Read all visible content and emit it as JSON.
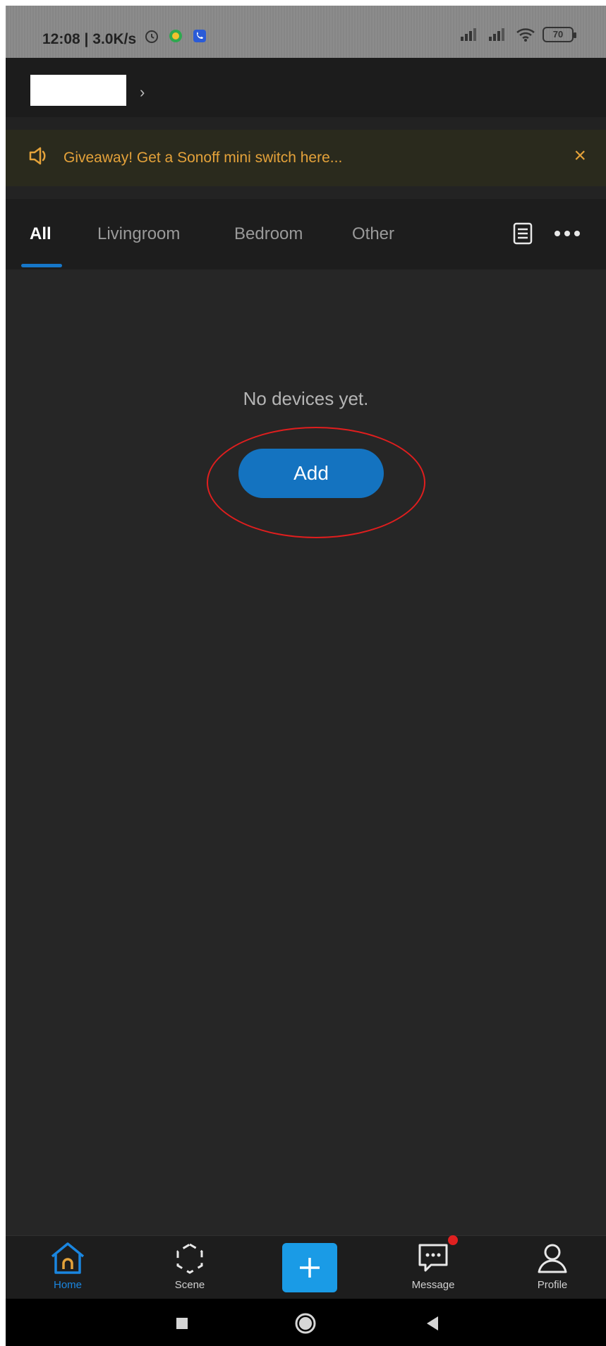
{
  "status_bar": {
    "time": "12:08",
    "speed": "3.0K/s",
    "battery": "70"
  },
  "banner": {
    "text": "Giveaway! Get a Sonoff mini switch here...",
    "close": "×"
  },
  "tabs": [
    {
      "label": "All",
      "active": true
    },
    {
      "label": "Livingroom"
    },
    {
      "label": "Bedroom"
    },
    {
      "label": "Other"
    }
  ],
  "empty_state": {
    "message": "No devices yet.",
    "add_label": "Add"
  },
  "bottom_nav": [
    {
      "label": "Home",
      "icon": "home-icon",
      "active": true
    },
    {
      "label": "Scene",
      "icon": "scene-icon"
    },
    {
      "label": "",
      "icon": "plus-icon"
    },
    {
      "label": "Message",
      "icon": "message-icon"
    },
    {
      "label": "Profile",
      "icon": "profile-icon"
    }
  ],
  "colors": {
    "accent": "#1473c0",
    "banner_text": "#e4a23a",
    "background": "#262626",
    "highlight": "#e01e1e"
  }
}
